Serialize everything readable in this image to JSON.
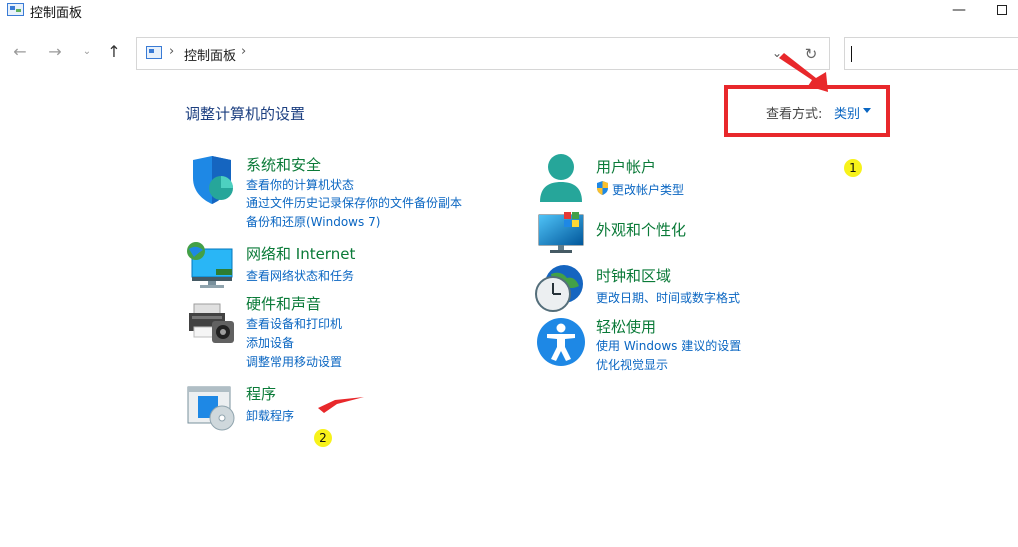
{
  "window": {
    "title": "控制面板",
    "minimize": "—"
  },
  "nav": {
    "back": "←",
    "forward": "→",
    "recent": "⌄",
    "up": "↑"
  },
  "address": {
    "separator": "›",
    "crumb": "控制面板",
    "dropdown": "⌄",
    "refresh": "↻"
  },
  "search": {
    "value": ""
  },
  "main": {
    "title": "调整计算机的设置",
    "view_by_label": "查看方式:",
    "view_by_value": "类别"
  },
  "categories": [
    {
      "title": "系统和安全",
      "icon": "shield-icon",
      "links": [
        "查看你的计算机状态",
        "通过文件历史记录保存你的文件备份副本",
        "备份和还原(Windows 7)"
      ]
    },
    {
      "title": "网络和 Internet",
      "icon": "network-icon",
      "links": [
        "查看网络状态和任务"
      ]
    },
    {
      "title": "硬件和声音",
      "icon": "printer-icon",
      "links": [
        "查看设备和打印机",
        "添加设备",
        "调整常用移动设置"
      ]
    },
    {
      "title": "程序",
      "icon": "programs-icon",
      "links": [
        "卸载程序"
      ]
    },
    {
      "title": "用户帐户",
      "icon": "user-icon",
      "links": [
        "更改帐户类型"
      ]
    },
    {
      "title": "外观和个性化",
      "icon": "monitor-icon",
      "links": []
    },
    {
      "title": "时钟和区域",
      "icon": "clock-icon",
      "links": [
        "更改日期、时间或数字格式"
      ]
    },
    {
      "title": "轻松使用",
      "icon": "accessibility-icon",
      "links": [
        "使用 Windows 建议的设置",
        "优化视觉显示"
      ]
    }
  ],
  "annotations": {
    "badge1": "1",
    "badge2": "2",
    "highlight_color": "#e8282b",
    "badge_color": "#f7f21a"
  }
}
